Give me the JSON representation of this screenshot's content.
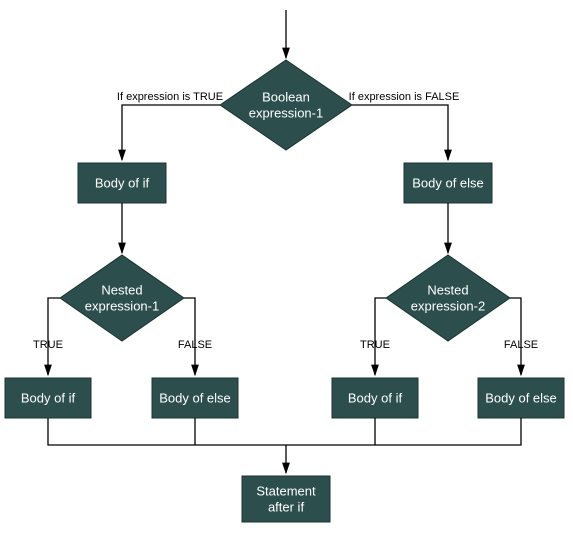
{
  "diagram": {
    "nodes": {
      "root_decision": {
        "line1": "Boolean",
        "line2": "expression-1"
      },
      "body_if": "Body of if",
      "body_else": "Body of else",
      "nested1": {
        "line1": "Nested",
        "line2": "expression-1"
      },
      "nested2": {
        "line1": "Nested",
        "line2": "expression-2"
      },
      "n1_true": "Body of if",
      "n1_false": "Body of else",
      "n2_true": "Body of if",
      "n2_false": "Body of else",
      "statement_after": {
        "line1": "Statement",
        "line2": "after if"
      }
    },
    "edges": {
      "root_true": "If expression is TRUE",
      "root_false": "If expression  is FALSE",
      "n1_true_lbl": "TRUE",
      "n1_false_lbl": "FALSE",
      "n2_true_lbl": "TRUE",
      "n2_false_lbl": "FALSE"
    },
    "colors": {
      "fill": "#2c4f4e",
      "stroke": "#1a3332",
      "text": "#ffffff",
      "edge": "#000000"
    }
  }
}
